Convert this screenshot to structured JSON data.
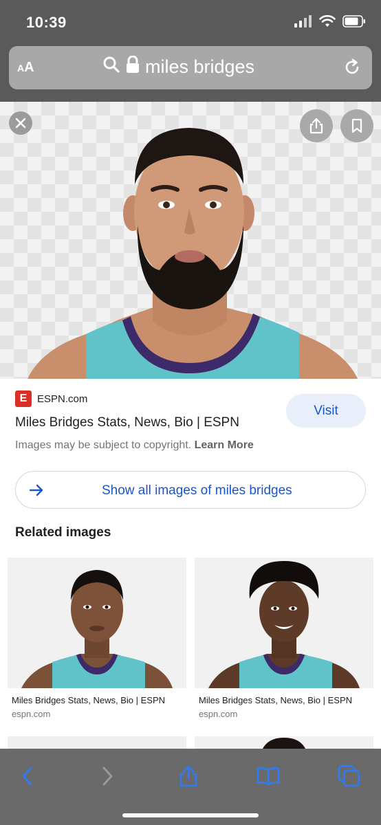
{
  "status": {
    "time": "10:39",
    "icons": [
      "cellular-signal-icon",
      "wifi-icon",
      "battery-icon"
    ]
  },
  "url_bar": {
    "text_size_label": "AA",
    "query": "miles bridges",
    "icons": [
      "search-icon",
      "lock-icon",
      "reload-icon"
    ]
  },
  "viewer": {
    "icons": [
      "close-icon",
      "share-icon",
      "bookmark-icon"
    ]
  },
  "result": {
    "source_name": "ESPN.com",
    "source_logo_letter": "E",
    "title": "Miles Bridges Stats, News, Bio | ESPN",
    "visit_label": "Visit",
    "copyright_text": "Images may be subject to copyright.",
    "learn_more_label": "Learn More",
    "show_all_label": "Show all images of miles bridges"
  },
  "related": {
    "heading": "Related images",
    "items": [
      {
        "caption": "Miles Bridges Stats, News, Bio | ESPN",
        "domain": "espn.com"
      },
      {
        "caption": "Miles Bridges Stats, News, Bio | ESPN",
        "domain": "espn.com"
      }
    ]
  },
  "toolbar": {
    "icons": [
      "back-icon",
      "forward-icon",
      "share-icon",
      "bookmarks-icon",
      "tabs-icon"
    ]
  },
  "colors": {
    "link_blue": "#1a56c8",
    "visit_bg": "#e8effb",
    "espn_red": "#d93025",
    "jersey_teal": "#5fc3c9",
    "jersey_purple": "#3c2a6b"
  }
}
